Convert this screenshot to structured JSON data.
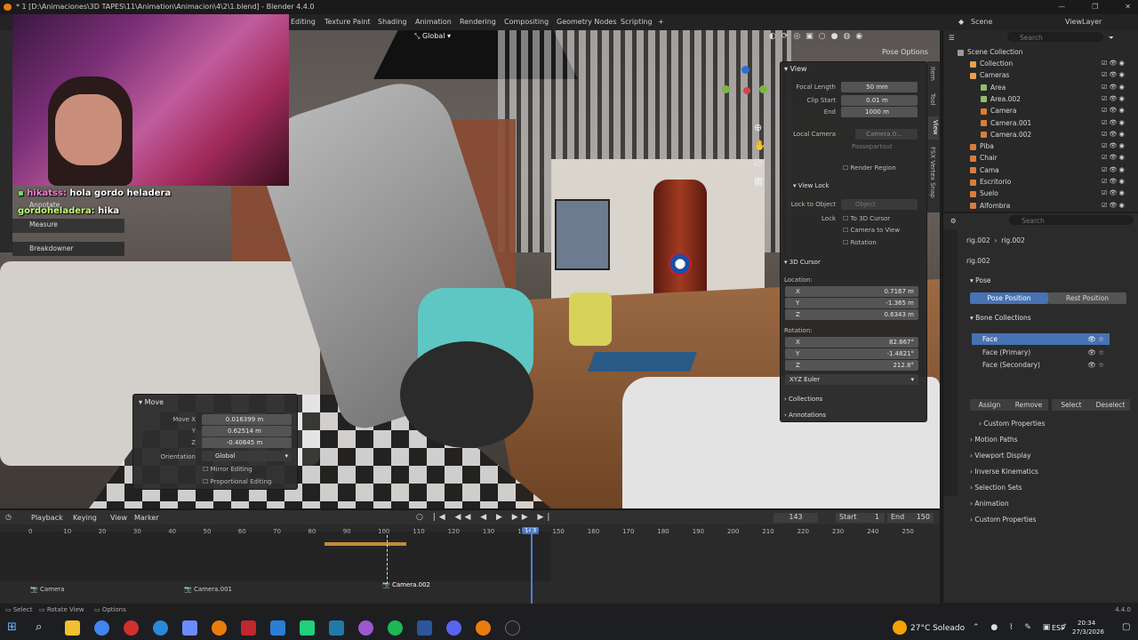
{
  "window": {
    "title": "* 1 [D:\\Animaciones\\3D TAPES\\11\\Animation\\Animacion\\4\\2\\1.blend] - Blender 4.4.0"
  },
  "workspaces": [
    "Editing",
    "Texture Paint",
    "Shading",
    "Animation",
    "Rendering",
    "Compositing",
    "Geometry Nodes",
    "Scripting"
  ],
  "header": {
    "orientation": "Global",
    "pose_options": "Pose Options",
    "scene": "Scene",
    "view_layer": "ViewLayer"
  },
  "chat": {
    "line1_user": "hikatss:",
    "line1_text": "hola gordo heladera",
    "line2_user": "gordoheladera:",
    "line2_text": "hika"
  },
  "tools": {
    "annotate": "Annotate",
    "measure": "Measure",
    "breakdowner": "Breakdowner"
  },
  "outliner": {
    "search_placeholder": "Search",
    "root": "Scene Collection",
    "items": [
      {
        "label": "Collection"
      },
      {
        "label": "Cameras"
      },
      {
        "label": "Area"
      },
      {
        "label": "Area.002"
      },
      {
        "label": "Camera"
      },
      {
        "label": "Camera.001"
      },
      {
        "label": "Camera.002"
      },
      {
        "label": "Piba"
      },
      {
        "label": "Chair"
      },
      {
        "label": "Cama"
      },
      {
        "label": "Escritorio"
      },
      {
        "label": "Suelo"
      },
      {
        "label": "Alfombra"
      }
    ]
  },
  "npanel": {
    "view_title": "View",
    "focal_length_label": "Focal Length",
    "focal_length": "50 mm",
    "clip_start_label": "Clip Start",
    "clip_start": "0.01 m",
    "clip_end_label": "End",
    "clip_end": "1000 m",
    "local_camera_label": "Local Camera",
    "local_camera": "Camera.0...",
    "passepartout": "Passepartout",
    "render_region": "Render Region",
    "view_lock_title": "View Lock",
    "lock_to_object_label": "Lock to Object",
    "lock_to_object_placeholder": "Object",
    "lock_label": "Lock",
    "to_3d_cursor": "To 3D Cursor",
    "camera_to_view": "Camera to View",
    "rotation": "Rotation",
    "cursor_title": "3D Cursor",
    "location_label": "Location:",
    "loc_x": "0.7167 m",
    "loc_y": "-1.365 m",
    "loc_z": "0.6343 m",
    "rotation_label": "Rotation:",
    "rot_x": "82.867°",
    "rot_y": "-1.4821°",
    "rot_z": "212.8°",
    "rot_mode": "XYZ Euler",
    "collections": "Collections",
    "annotations": "Annotations",
    "tabs": [
      "Item",
      "Tool",
      "View",
      "FSX Vertex Snap"
    ]
  },
  "props": {
    "search_placeholder": "Search",
    "breadcrumb_1": "rig.002",
    "breadcrumb_2": "rig.002",
    "armature_name": "rig.002",
    "pose_section": "Pose",
    "pose_position": "Pose Position",
    "rest_position": "Rest Position",
    "bone_collections": "Bone Collections",
    "bone_items": [
      "Face",
      "Face (Primary)",
      "Face (Secondary)"
    ],
    "assign": "Assign",
    "remove": "Remove",
    "select": "Select",
    "deselect": "Deselect",
    "custom_props_1": "Custom Properties",
    "motion_paths": "Motion Paths",
    "viewport_display": "Viewport Display",
    "inverse_kinematics": "Inverse Kinematics",
    "selection_sets": "Selection Sets",
    "animation": "Animation",
    "custom_props_2": "Custom Properties"
  },
  "move_panel": {
    "title": "Move",
    "move_x_label": "Move X",
    "move_x": "0.016399 m",
    "y_label": "Y",
    "y": "0.62514 m",
    "z_label": "Z",
    "z": "-0.40645 m",
    "orientation_label": "Orientation",
    "orientation": "Global",
    "mirror_editing": "Mirror Editing",
    "proportional_editing": "Proportional Editing"
  },
  "timeline": {
    "playback": "Playback",
    "keying": "Keying",
    "view": "View",
    "marker": "Marker",
    "current_frame": "143",
    "start_label": "Start",
    "start": "1",
    "end_label": "End",
    "end": "150",
    "ruler": [
      "0",
      "10",
      "20",
      "30",
      "40",
      "50",
      "60",
      "70",
      "80",
      "90",
      "100",
      "110",
      "120",
      "130",
      "140",
      "150",
      "160",
      "170",
      "180",
      "190",
      "200",
      "210",
      "220",
      "230",
      "240",
      "250"
    ],
    "markers": [
      "Camera",
      "Camera.001",
      "Camera.002"
    ]
  },
  "statusbar": {
    "select": "Select",
    "rotate_view": "Rotate View",
    "options": "Options",
    "version": "4.4.0"
  },
  "taskbar": {
    "weather": "27°C  Soleado",
    "lang": "ESP",
    "time": "20:34",
    "date": "27/3/2026"
  },
  "colors": {
    "accent_blue": "#4772b3",
    "blender_orange": "#e87d0d",
    "keyframe_orange": "#e0a040",
    "playhead": "#4f7fd0"
  }
}
